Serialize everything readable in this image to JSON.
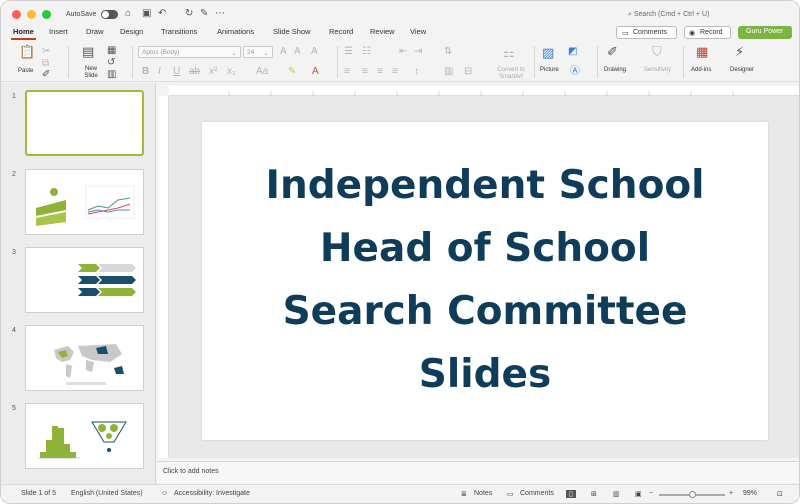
{
  "titlebar": {
    "autosave_label": "AutoSave",
    "search_placeholder": "Search (Cmd + Ctrl + U)"
  },
  "tabs": [
    "Home",
    "Insert",
    "Draw",
    "Design",
    "Transitions",
    "Animations",
    "Slide Show",
    "Record",
    "Review",
    "View"
  ],
  "actions": {
    "comments": "Comments",
    "record": "Record",
    "guru": "Guru Power"
  },
  "ribbon": {
    "paste": "Paste",
    "new_slide": "New Slide",
    "font_name": "Aptos (Body)",
    "font_size": "24",
    "convert_smartart": "Convert to SmartArt",
    "picture": "Picture",
    "drawing": "Drawing",
    "sensitivity": "Sensitivity",
    "addins": "Add-ins",
    "designer": "Designer"
  },
  "thumbnails": [
    {
      "number": "1"
    },
    {
      "number": "2"
    },
    {
      "number": "3"
    },
    {
      "number": "4"
    },
    {
      "number": "5"
    }
  ],
  "slide": {
    "title_lines": [
      "Independent School",
      "Head of School",
      "Search Committee",
      "Slides"
    ]
  },
  "notes": {
    "placeholder": "Click to add notes"
  },
  "status": {
    "slide_count": "Slide 1 of 5",
    "language": "English (United States)",
    "accessibility": "Accessibility: Investigate",
    "notes": "Notes",
    "comments": "Comments",
    "zoom": "99%"
  },
  "colors": {
    "title_text": "#0e3c59",
    "accent_green": "#7cb342",
    "selected_border": "#a5b83d",
    "tab_underline": "#c43e1c"
  }
}
